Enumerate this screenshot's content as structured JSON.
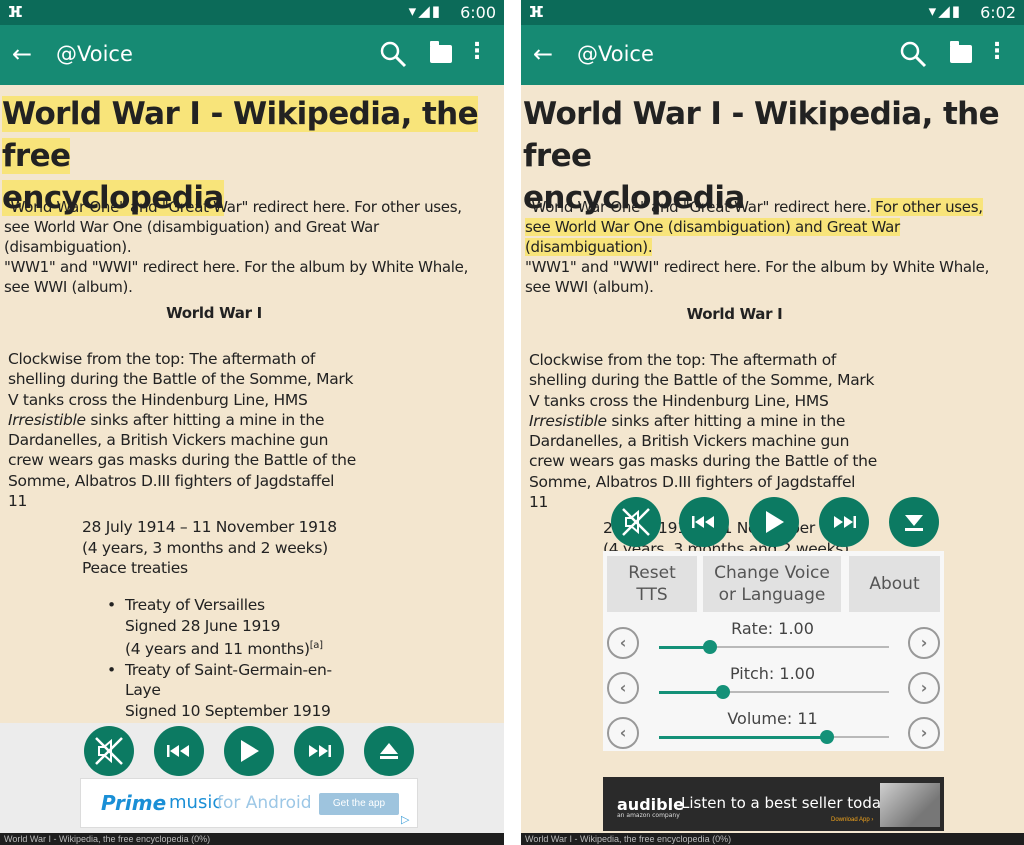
{
  "status_left": {
    "time": "6:00"
  },
  "status_right": {
    "time": "6:02"
  },
  "toolbar": {
    "title": "@Voice"
  },
  "article": {
    "title_line1": "World War I - Wikipedia, the free",
    "title_line2": "encyclopedia",
    "redirect_1a": "\"World War One\" and \"Great War\" redirect here.",
    "redirect_1b": " For other uses,",
    "redirect_1c": "see World War One (disambiguation) and Great War",
    "redirect_1d": "(disambiguation).",
    "redirect_2a": "\"WW1\" and \"WWI\" redirect here. For the album by White Whale,",
    "redirect_2b": "see WWI (album).",
    "infobox_title": "World War I",
    "caption_1": "Clockwise from the top: The aftermath of",
    "caption_2": "shelling during the Battle of the Somme, Mark",
    "caption_3": "V tanks cross the Hindenburg Line, HMS",
    "caption_4_italic": "Irresistible",
    "caption_4_rest": " sinks after hitting a mine in the",
    "caption_5": "Dardanelles, a British Vickers machine gun",
    "caption_6": "crew wears gas masks during the Battle of the",
    "caption_7": "Somme, Albatros D.III fighters of Jagdstaffel",
    "caption_8": "11",
    "dates_1": "28 July 1914 – 11 November 1918",
    "dates_2": "(4 years, 3 months and 2 weeks)",
    "dates_3": "Peace treaties",
    "treaty_1": "Treaty of Versailles",
    "treaty_1_signed": "Signed 28 June 1919",
    "treaty_1_dur": "(4 years and 11 months)",
    "treaty_1_ref": "[a]",
    "treaty_2a": "Treaty of Saint-Germain-en-",
    "treaty_2b": "Laye",
    "treaty_2_signed": "Signed 10 September 1919"
  },
  "ad_left": {
    "prime": "Prime",
    "music": "music",
    "for": "for Android",
    "cta": "Get the app"
  },
  "overlay": {
    "reset_l1": "Reset",
    "reset_l2": "TTS",
    "change_l1": "Change Voice",
    "change_l2": "or Language",
    "about": "About",
    "rate_label": "Rate: 1.00",
    "rate_value": 0.22,
    "pitch_label": "Pitch: 1.00",
    "pitch_value": 0.28,
    "volume_label": "Volume: 11",
    "volume_value": 0.73
  },
  "ad_right": {
    "brand": "audible",
    "brand_sub": "an amazon company",
    "text": "Listen to a best seller today",
    "cta": "Download App ›"
  },
  "footer": {
    "text": "World War I - Wikipedia, the free encyclopedia (0%)"
  },
  "colors": {
    "toolbar": "#168a73",
    "statusbar": "#0c6b59",
    "accent": "#149178",
    "highlight": "#f8e47a",
    "page_bg": "#f3e6cf"
  }
}
